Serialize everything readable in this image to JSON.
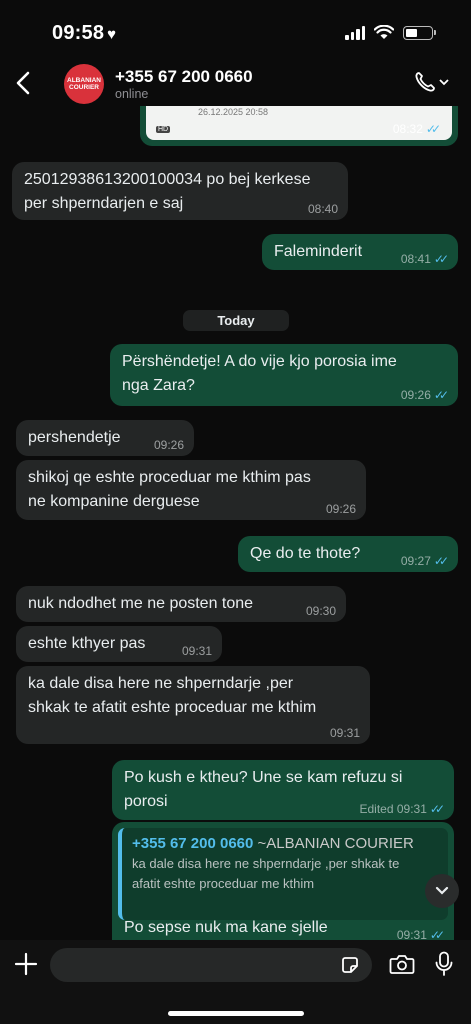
{
  "status_bar": {
    "time": "09:58"
  },
  "header": {
    "contact_name": "+355 67 200 0660",
    "contact_status": "online",
    "avatar_text": "ALBANIAN COURIER"
  },
  "image_preview": {
    "date_text": "26.12.2025 20:58",
    "hd": "HD",
    "time": "08:32"
  },
  "messages": [
    {
      "dir": "in",
      "text_lines": [
        "25012938613200100034 po bej kerkese",
        "per shperndarjen e saj"
      ],
      "time": "08:40"
    },
    {
      "dir": "out",
      "text_lines": [
        "Faleminderit"
      ],
      "time": "08:41"
    },
    {
      "dir": "out",
      "text_lines": [
        "Përshëndetje! A do vije kjo porosia ime",
        "nga Zara?"
      ],
      "time": "09:26"
    },
    {
      "dir": "in",
      "text_lines": [
        "pershendetje"
      ],
      "time": "09:26"
    },
    {
      "dir": "in",
      "text_lines": [
        "shikoj qe eshte proceduar me kthim pas",
        "ne kompanine derguese"
      ],
      "time": "09:26"
    },
    {
      "dir": "out",
      "text_lines": [
        "Qe do te thote?"
      ],
      "time": "09:27"
    },
    {
      "dir": "in",
      "text_lines": [
        "nuk ndodhet me ne posten tone"
      ],
      "time": "09:30"
    },
    {
      "dir": "in",
      "text_lines": [
        "eshte kthyer pas"
      ],
      "time": "09:31"
    },
    {
      "dir": "in",
      "text_lines": [
        "ka dale disa here ne shperndarje ,per",
        "shkak te afatit eshte proceduar me kthim"
      ],
      "time": "09:31"
    },
    {
      "dir": "out",
      "text_lines": [
        "Po kush e ktheu? Une se kam refuzu si",
        "porosi"
      ],
      "time": "Edited 09:31"
    },
    {
      "dir": "out",
      "text_lines": [
        "Po sepse nuk ma kane sjelle"
      ],
      "time": "09:31"
    }
  ],
  "date_divider": "Today",
  "quote": {
    "name": "+355 67 200 0660",
    "tag": "~ALBANIAN COURIER",
    "text_lines": [
      "ka dale disa here ne shperndarje ,per shkak te",
      "afatit eshte proceduar me kthim"
    ]
  },
  "colors": {
    "incoming": "#242626",
    "outgoing": "#134d37",
    "read_ticks": "#53bdeb",
    "avatar": "#d9323b"
  }
}
